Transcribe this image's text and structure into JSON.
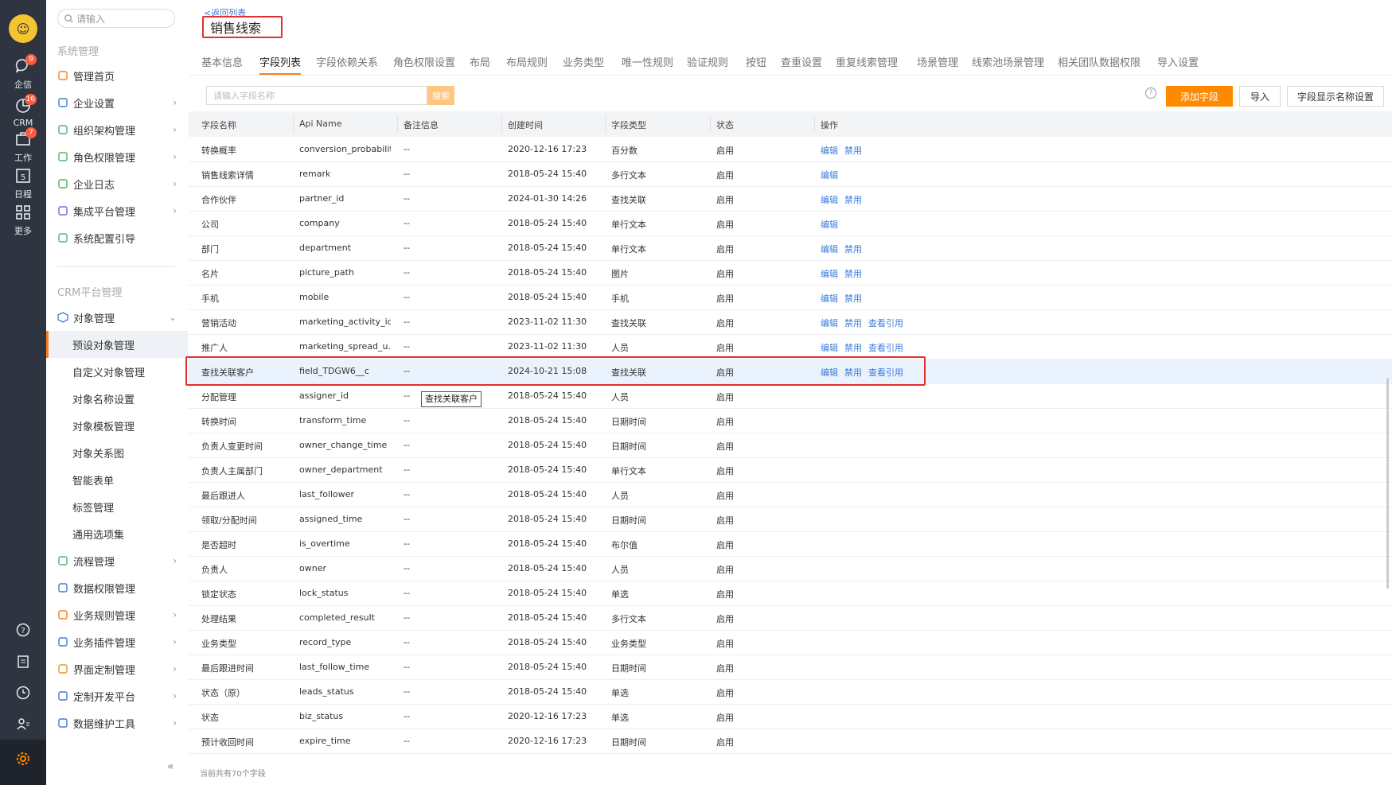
{
  "rail": {
    "items": [
      {
        "label": "企信",
        "badge": "9"
      },
      {
        "label": "CRM",
        "badge": "16"
      },
      {
        "label": "工作",
        "badge": "7"
      },
      {
        "label": "日程",
        "badge": ""
      },
      {
        "label": "更多",
        "badge": ""
      }
    ]
  },
  "sidebar": {
    "search_placeholder": "请输入",
    "system_title": "系统管理",
    "system_items": [
      "管理首页",
      "企业设置",
      "组织架构管理",
      "角色权限管理",
      "企业日志",
      "集成平台管理",
      "系统配置引导"
    ],
    "crm_title": "CRM平台管理",
    "object_mgmt": "对象管理",
    "object_sub": [
      "预设对象管理",
      "自定义对象管理",
      "对象名称设置",
      "对象模板管理",
      "对象关系图",
      "智能表单",
      "标签管理",
      "通用选项集"
    ],
    "crm_items": [
      "流程管理",
      "数据权限管理",
      "业务规则管理",
      "业务插件管理",
      "界面定制管理",
      "定制开发平台",
      "数据维护工具"
    ]
  },
  "main": {
    "back": "<返回列表",
    "title": "销售线索",
    "tabs": [
      "基本信息",
      "字段列表",
      "字段依赖关系",
      "角色权限设置",
      "布局",
      "布局规则",
      "业务类型",
      "唯一性规则",
      "验证规则",
      "按钮",
      "查重设置",
      "重复线索管理",
      "场景管理",
      "线索池场景管理",
      "相关团队数据权限",
      "导入设置"
    ],
    "active_tab": "字段列表",
    "field_search_placeholder": "请输入字段名称",
    "search_btn": "搜索",
    "add_field_btn": "添加字段",
    "import_btn": "导入",
    "display_name_btn": "字段显示名称设置",
    "columns": [
      "字段名称",
      "Api Name",
      "备注信息",
      "创建时间",
      "字段类型",
      "状态",
      "操作"
    ],
    "rows": [
      {
        "name": "转换概率",
        "api": "conversion_probability",
        "note": "--",
        "created": "2020-12-16 17:23",
        "type": "百分数",
        "status": "启用",
        "actions": [
          "编辑",
          "禁用"
        ]
      },
      {
        "name": "销售线索详情",
        "api": "remark",
        "note": "--",
        "created": "2018-05-24 15:40",
        "type": "多行文本",
        "status": "启用",
        "actions": [
          "编辑"
        ]
      },
      {
        "name": "合作伙伴",
        "api": "partner_id",
        "note": "--",
        "created": "2024-01-30 14:26",
        "type": "查找关联",
        "status": "启用",
        "actions": [
          "编辑",
          "禁用"
        ]
      },
      {
        "name": "公司",
        "api": "company",
        "note": "--",
        "created": "2018-05-24 15:40",
        "type": "单行文本",
        "status": "启用",
        "actions": [
          "编辑"
        ]
      },
      {
        "name": "部门",
        "api": "department",
        "note": "--",
        "created": "2018-05-24 15:40",
        "type": "单行文本",
        "status": "启用",
        "actions": [
          "编辑",
          "禁用"
        ]
      },
      {
        "name": "名片",
        "api": "picture_path",
        "note": "--",
        "created": "2018-05-24 15:40",
        "type": "图片",
        "status": "启用",
        "actions": [
          "编辑",
          "禁用"
        ]
      },
      {
        "name": "手机",
        "api": "mobile",
        "note": "--",
        "created": "2018-05-24 15:40",
        "type": "手机",
        "status": "启用",
        "actions": [
          "编辑",
          "禁用"
        ]
      },
      {
        "name": "营销活动",
        "api": "marketing_activity_id...",
        "note": "--",
        "created": "2023-11-02 11:30",
        "type": "查找关联",
        "status": "启用",
        "actions": [
          "编辑",
          "禁用",
          "查看引用"
        ]
      },
      {
        "name": "推广人",
        "api": "marketing_spread_u...",
        "note": "--",
        "created": "2023-11-02 11:30",
        "type": "人员",
        "status": "启用",
        "actions": [
          "编辑",
          "禁用",
          "查看引用"
        ]
      },
      {
        "name": "查找关联客户",
        "api": "field_TDGW6__c",
        "note": "--",
        "created": "2024-10-21 15:08",
        "type": "查找关联",
        "status": "启用",
        "actions": [
          "编辑",
          "禁用",
          "查看引用"
        ]
      },
      {
        "name": "分配管理",
        "api": "assigner_id",
        "note": "--",
        "created": "2018-05-24 15:40",
        "type": "人员",
        "status": "启用",
        "actions": []
      },
      {
        "name": "转换时间",
        "api": "transform_time",
        "note": "--",
        "created": "2018-05-24 15:40",
        "type": "日期时间",
        "status": "启用",
        "actions": []
      },
      {
        "name": "负责人变更时间",
        "api": "owner_change_time",
        "note": "--",
        "created": "2018-05-24 15:40",
        "type": "日期时间",
        "status": "启用",
        "actions": []
      },
      {
        "name": "负责人主属部门",
        "api": "owner_department",
        "note": "--",
        "created": "2018-05-24 15:40",
        "type": "单行文本",
        "status": "启用",
        "actions": []
      },
      {
        "name": "最后跟进人",
        "api": "last_follower",
        "note": "--",
        "created": "2018-05-24 15:40",
        "type": "人员",
        "status": "启用",
        "actions": []
      },
      {
        "name": "领取/分配时间",
        "api": "assigned_time",
        "note": "--",
        "created": "2018-05-24 15:40",
        "type": "日期时间",
        "status": "启用",
        "actions": []
      },
      {
        "name": "是否超时",
        "api": "is_overtime",
        "note": "--",
        "created": "2018-05-24 15:40",
        "type": "布尔值",
        "status": "启用",
        "actions": []
      },
      {
        "name": "负责人",
        "api": "owner",
        "note": "--",
        "created": "2018-05-24 15:40",
        "type": "人员",
        "status": "启用",
        "actions": []
      },
      {
        "name": "锁定状态",
        "api": "lock_status",
        "note": "--",
        "created": "2018-05-24 15:40",
        "type": "单选",
        "status": "启用",
        "actions": []
      },
      {
        "name": "处理结果",
        "api": "completed_result",
        "note": "--",
        "created": "2018-05-24 15:40",
        "type": "多行文本",
        "status": "启用",
        "actions": []
      },
      {
        "name": "业务类型",
        "api": "record_type",
        "note": "--",
        "created": "2018-05-24 15:40",
        "type": "业务类型",
        "status": "启用",
        "actions": []
      },
      {
        "name": "最后跟进时间",
        "api": "last_follow_time",
        "note": "--",
        "created": "2018-05-24 15:40",
        "type": "日期时间",
        "status": "启用",
        "actions": []
      },
      {
        "name": "状态（原）",
        "api": "leads_status",
        "note": "--",
        "created": "2018-05-24 15:40",
        "type": "单选",
        "status": "启用",
        "actions": []
      },
      {
        "name": "状态",
        "api": "biz_status",
        "note": "--",
        "created": "2020-12-16 17:23",
        "type": "单选",
        "status": "启用",
        "actions": []
      },
      {
        "name": "预计收回时间",
        "api": "expire_time",
        "note": "--",
        "created": "2020-12-16 17:23",
        "type": "日期时间",
        "status": "启用",
        "actions": []
      }
    ],
    "tooltip": "查找关联客户",
    "footer": "当前共有70个字段"
  },
  "colors": {
    "accent": "#ff8a00",
    "link": "#3e7bd8",
    "highlight": "#e32f2f",
    "rail": "#2e3440"
  }
}
